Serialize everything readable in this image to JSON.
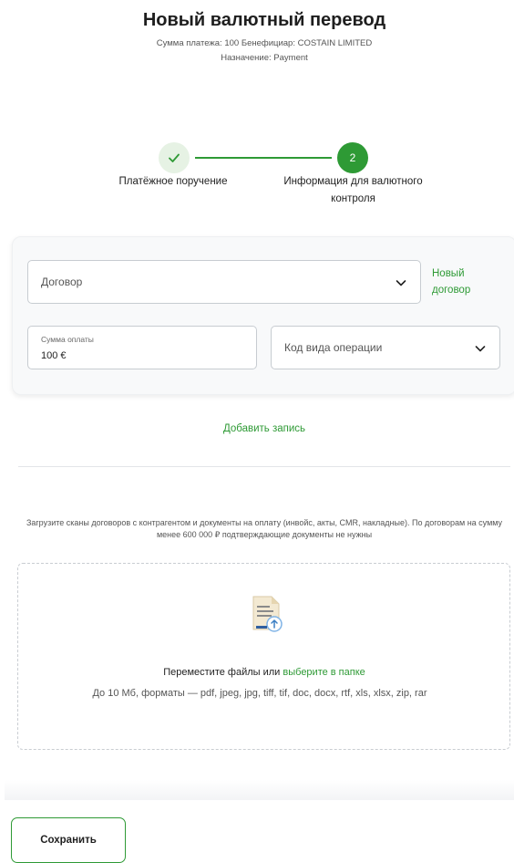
{
  "header": {
    "title": "Новый валютный перевод",
    "subtitle_line1": "Сумма платежа: 100 Бенефициар: COSTAIN LIMITED",
    "subtitle_line2": "Назначение: Payment"
  },
  "stepper": {
    "step1_label": "Платёжное поручение",
    "step1_status": "completed",
    "step2_number": "2",
    "step2_label": "Информация для валютного контроля"
  },
  "form": {
    "contract_placeholder": "Договор",
    "new_contract_link": "Новый договор",
    "sum_label": "Сумма оплаты",
    "sum_value": "100 €",
    "operation_code_placeholder": "Код вида операции",
    "add_record_link": "Добавить запись"
  },
  "upload": {
    "hint": "Загрузите сканы договоров с контрагентом и документы на оплату (инвойс, акты, CMR, накладные). По договорам на сумму менее 600 000 ₽ подтверждающие документы не нужны",
    "drop_text": "Переместите файлы или",
    "drop_link": "выберите в папке",
    "formats": "До 10 Мб, форматы — pdf, jpeg, jpg, tiff, tif, doc, docx, rtf, xls, xlsx, zip, rar"
  },
  "footer": {
    "save_label": "Сохранить"
  },
  "colors": {
    "accent": "#2e9a35",
    "accent_light": "#e6f2e4"
  }
}
